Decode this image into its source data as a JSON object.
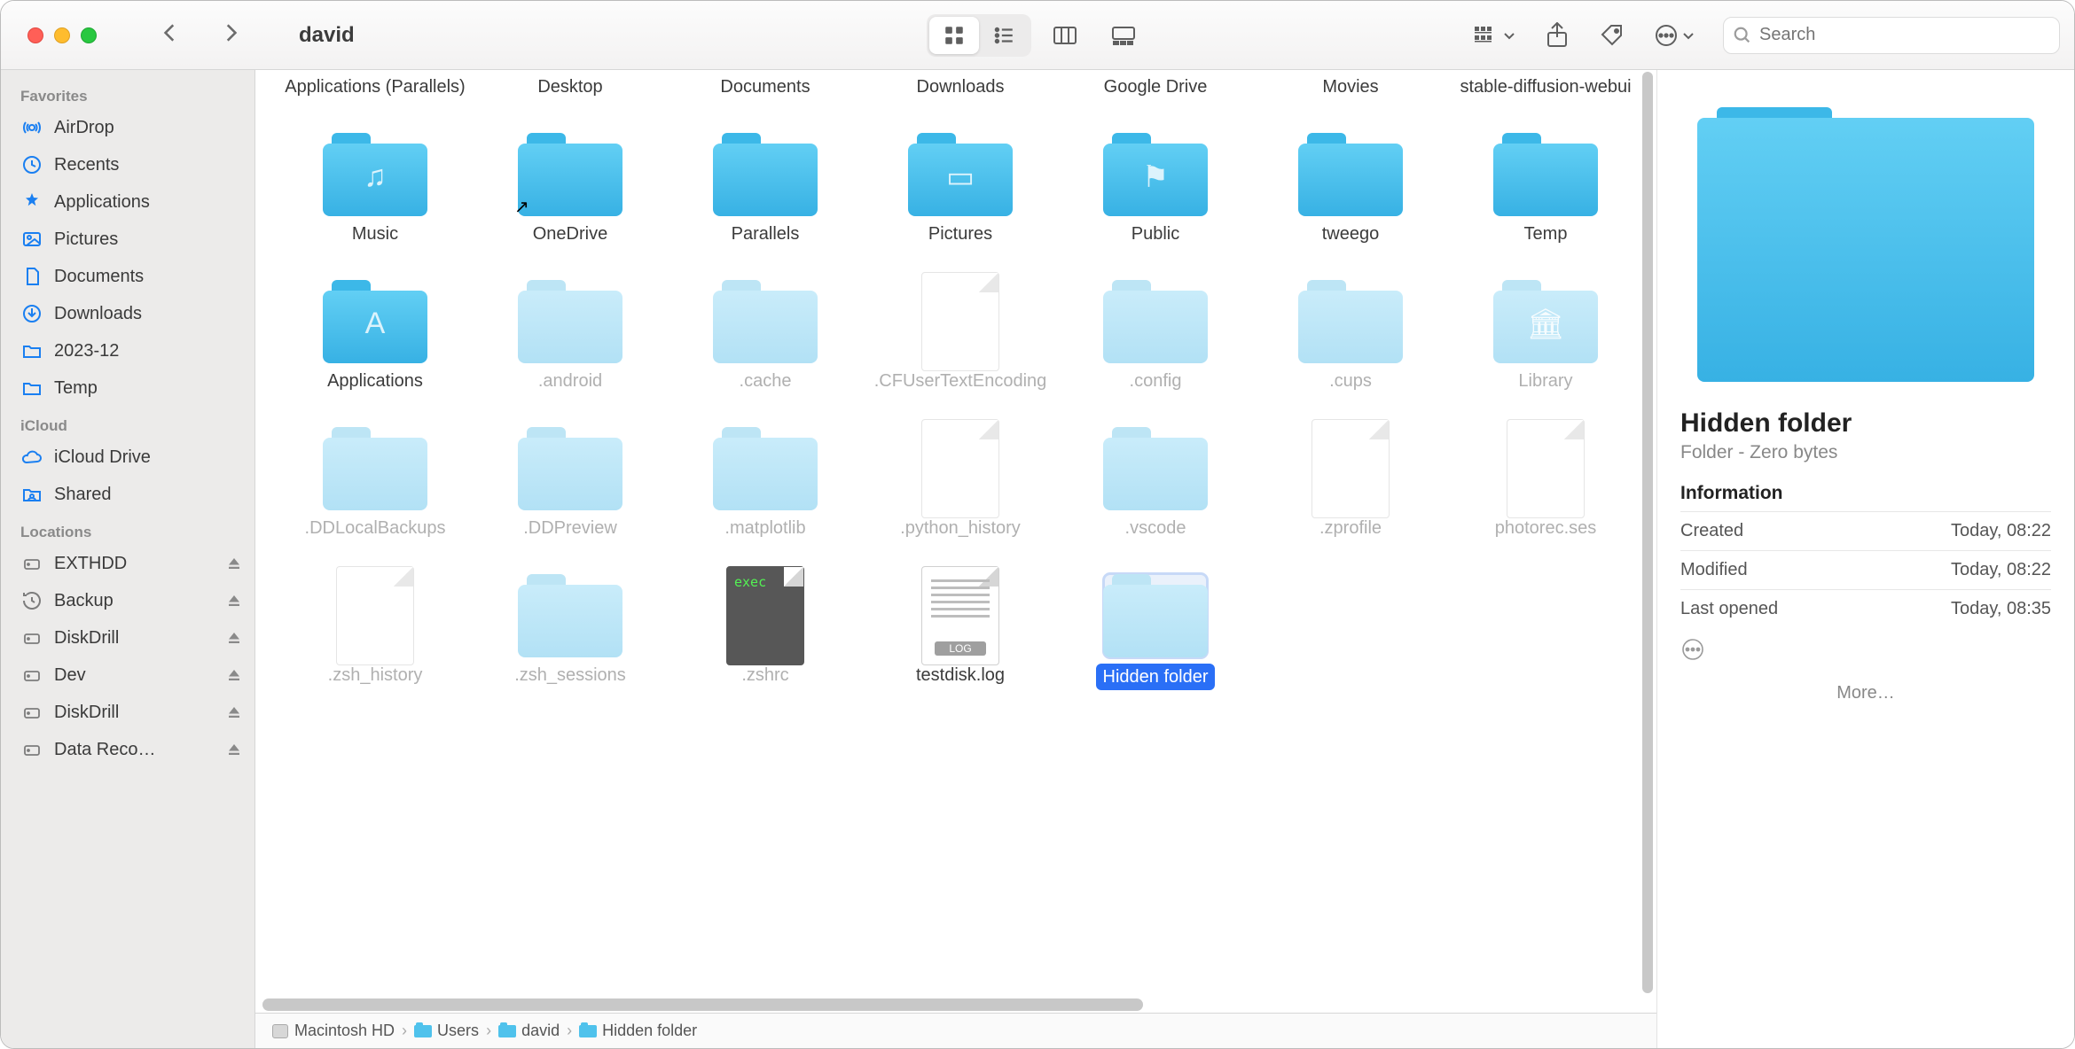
{
  "window_title": "david",
  "search_placeholder": "Search",
  "sidebar": {
    "sections": [
      {
        "header": "Favorites",
        "items": [
          {
            "icon": "airdrop",
            "label": "AirDrop"
          },
          {
            "icon": "clock",
            "label": "Recents"
          },
          {
            "icon": "apps",
            "label": "Applications"
          },
          {
            "icon": "pictures",
            "label": "Pictures"
          },
          {
            "icon": "doc",
            "label": "Documents"
          },
          {
            "icon": "downloads",
            "label": "Downloads"
          },
          {
            "icon": "folder",
            "label": "2023-12"
          },
          {
            "icon": "folder",
            "label": "Temp"
          }
        ]
      },
      {
        "header": "iCloud",
        "items": [
          {
            "icon": "cloud",
            "label": "iCloud Drive"
          },
          {
            "icon": "shared",
            "label": "Shared"
          }
        ]
      },
      {
        "header": "Locations",
        "loc": true,
        "items": [
          {
            "icon": "ext",
            "label": "EXTHDD",
            "eject": true
          },
          {
            "icon": "time",
            "label": "Backup",
            "eject": true
          },
          {
            "icon": "ext",
            "label": "DiskDrill",
            "eject": true
          },
          {
            "icon": "ext",
            "label": "Dev",
            "eject": true
          },
          {
            "icon": "ext",
            "label": "DiskDrill",
            "eject": true
          },
          {
            "icon": "ext",
            "label": "Data Reco…",
            "eject": true
          }
        ]
      }
    ]
  },
  "items": [
    {
      "kind": "label",
      "label": "Applications (Parallels)"
    },
    {
      "kind": "label",
      "label": "Desktop"
    },
    {
      "kind": "label",
      "label": "Documents"
    },
    {
      "kind": "label",
      "label": "Downloads"
    },
    {
      "kind": "label",
      "label": "Google Drive"
    },
    {
      "kind": "label",
      "label": "Movies"
    },
    {
      "kind": "label",
      "label": "stable-diffusion-webui"
    },
    {
      "kind": "folder",
      "label": "Music",
      "glyph": "♫"
    },
    {
      "kind": "folder",
      "label": "OneDrive",
      "alias": true
    },
    {
      "kind": "folder",
      "label": "Parallels"
    },
    {
      "kind": "folder",
      "label": "Pictures",
      "glyph": "▭"
    },
    {
      "kind": "folder",
      "label": "Public",
      "glyph": "⚑"
    },
    {
      "kind": "folder",
      "label": "tweego"
    },
    {
      "kind": "folder",
      "label": "Temp"
    },
    {
      "kind": "folder",
      "label": "Applications",
      "glyph": "A"
    },
    {
      "kind": "folder",
      "label": ".android",
      "hidden": true
    },
    {
      "kind": "folder",
      "label": ".cache",
      "hidden": true
    },
    {
      "kind": "file",
      "label": ".CFUserTextEncoding",
      "hidden": true
    },
    {
      "kind": "folder",
      "label": ".config",
      "hidden": true
    },
    {
      "kind": "folder",
      "label": ".cups",
      "hidden": true
    },
    {
      "kind": "folder",
      "label": "Library",
      "hidden": true,
      "glyph": "🏛"
    },
    {
      "kind": "folder",
      "label": ".DDLocalBackups",
      "hidden": true
    },
    {
      "kind": "folder",
      "label": ".DDPreview",
      "hidden": true
    },
    {
      "kind": "folder",
      "label": ".matplotlib",
      "hidden": true
    },
    {
      "kind": "file",
      "label": ".python_history",
      "hidden": true
    },
    {
      "kind": "folder",
      "label": ".vscode",
      "hidden": true
    },
    {
      "kind": "file",
      "label": ".zprofile",
      "hidden": true
    },
    {
      "kind": "file",
      "label": "photorec.ses",
      "hidden": true
    },
    {
      "kind": "file",
      "label": ".zsh_history",
      "hidden": true
    },
    {
      "kind": "folder",
      "label": ".zsh_sessions",
      "hidden": true
    },
    {
      "kind": "exec",
      "label": ".zshrc",
      "hidden": true,
      "exec_text": "exec"
    },
    {
      "kind": "log",
      "label": "testdisk.log",
      "badge": "LOG"
    },
    {
      "kind": "folder",
      "label": "Hidden folder",
      "hidden": true,
      "selected": true
    }
  ],
  "preview": {
    "title": "Hidden folder",
    "subtitle": "Folder - Zero bytes",
    "section": "Information",
    "rows": [
      {
        "k": "Created",
        "v": "Today, 08:22"
      },
      {
        "k": "Modified",
        "v": "Today, 08:22"
      },
      {
        "k": "Last opened",
        "v": "Today, 08:35"
      }
    ],
    "more": "More…"
  },
  "path": [
    {
      "icon": "hd",
      "label": "Macintosh HD"
    },
    {
      "icon": "folder",
      "label": "Users"
    },
    {
      "icon": "folder",
      "label": "david"
    },
    {
      "icon": "folder",
      "label": "Hidden folder"
    }
  ]
}
